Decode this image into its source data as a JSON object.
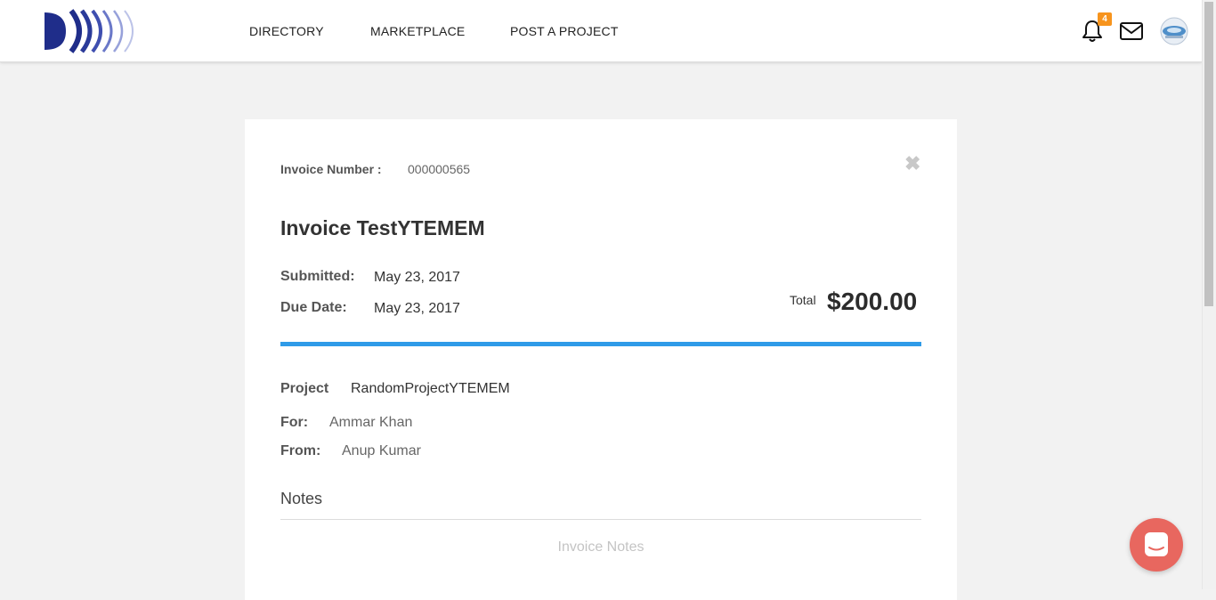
{
  "nav": {
    "links": [
      "DIRECTORY",
      "MARKETPLACE",
      "POST A PROJECT"
    ],
    "notification_count": "4"
  },
  "invoice": {
    "number_label": "Invoice Number :",
    "number_value": "000000565",
    "title": "Invoice TestYTEMEM",
    "submitted_label": "Submitted:",
    "submitted_value": "May 23, 2017",
    "due_label": "Due Date:",
    "due_value": "May 23, 2017",
    "total_label": "Total",
    "total_value": "$200.00",
    "project_label": "Project",
    "project_value": "RandomProjectYTEMEM",
    "for_label": "For:",
    "for_value": "Ammar Khan",
    "from_label": "From:",
    "from_value": "Anup Kumar",
    "notes_heading": "Notes",
    "notes_placeholder": "Invoice Notes",
    "close_icon": "✖"
  },
  "colors": {
    "accent_blue": "#2f9be8",
    "badge_orange": "#f7941d",
    "chat_coral": "#e8675f",
    "logo_navy": "#1f2d8a"
  },
  "icons": [
    "logo-icon",
    "bell-icon",
    "mail-icon",
    "avatar-icon",
    "close-icon",
    "chat-icon"
  ]
}
